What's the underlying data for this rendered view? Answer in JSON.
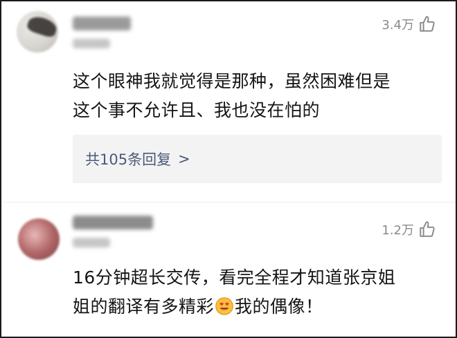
{
  "comments": [
    {
      "likes": "3.4万",
      "text_lines": [
        "这个眼神我就觉得是那种，虽然困难但是",
        "这个事不允许且、我也没在怕的"
      ],
      "replies_label": "共105条回复",
      "replies_chevron": ">"
    },
    {
      "likes": "1.2万",
      "text_line1": "16分钟超长交传，看完全程才知道张京姐",
      "text_line2_before": "姐的翻译有多精彩",
      "emoji": "heart-eyes-emoji",
      "text_line2_after": "我的偶像！"
    }
  ],
  "icons": {
    "like": "thumbs-up-icon"
  },
  "colors": {
    "reply_link": "#4a5a78",
    "meta_gray": "#8a8a8a",
    "reply_bg": "#f3f3f3"
  }
}
